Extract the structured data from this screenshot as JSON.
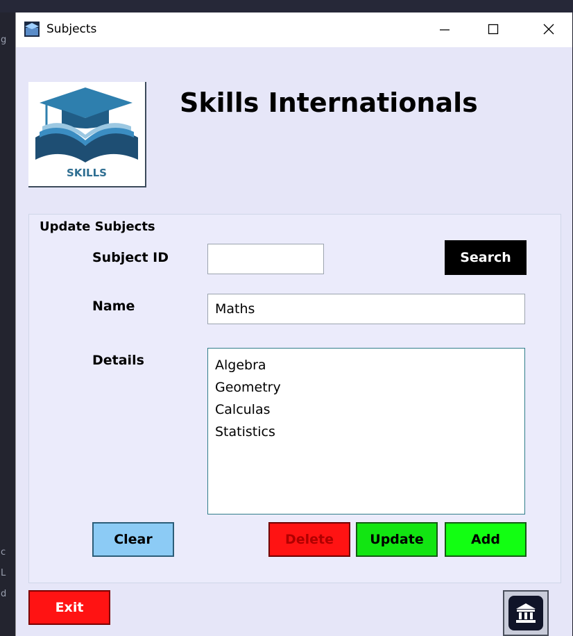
{
  "window": {
    "title": "Subjects",
    "controls": {
      "minimize": "—",
      "maximize": "☐",
      "close": "✕"
    }
  },
  "header": {
    "logo_text": "SKILLS",
    "company_name": "Skills Internationals"
  },
  "form": {
    "group_title": "Update Subjects",
    "subject_id": {
      "label": "Subject ID",
      "value": ""
    },
    "name": {
      "label": "Name",
      "value": "Maths"
    },
    "details": {
      "label": "Details",
      "lines": [
        "Algebra",
        "Geometry",
        "Calculas",
        "Statistics"
      ]
    }
  },
  "buttons": {
    "search": "Search",
    "clear": "Clear",
    "delete": "Delete",
    "update": "Update",
    "add": "Add",
    "exit": "Exit"
  },
  "icons": {
    "app": "app-icon",
    "home": "bank-building-icon"
  },
  "colors": {
    "window_bg": "#e6e6f8",
    "search_bg": "#000000",
    "clear_bg": "#8ccbf5",
    "delete_bg": "#ff1313",
    "update_bg": "#12e512",
    "add_bg": "#12ff12",
    "exit_bg": "#ff1313"
  }
}
